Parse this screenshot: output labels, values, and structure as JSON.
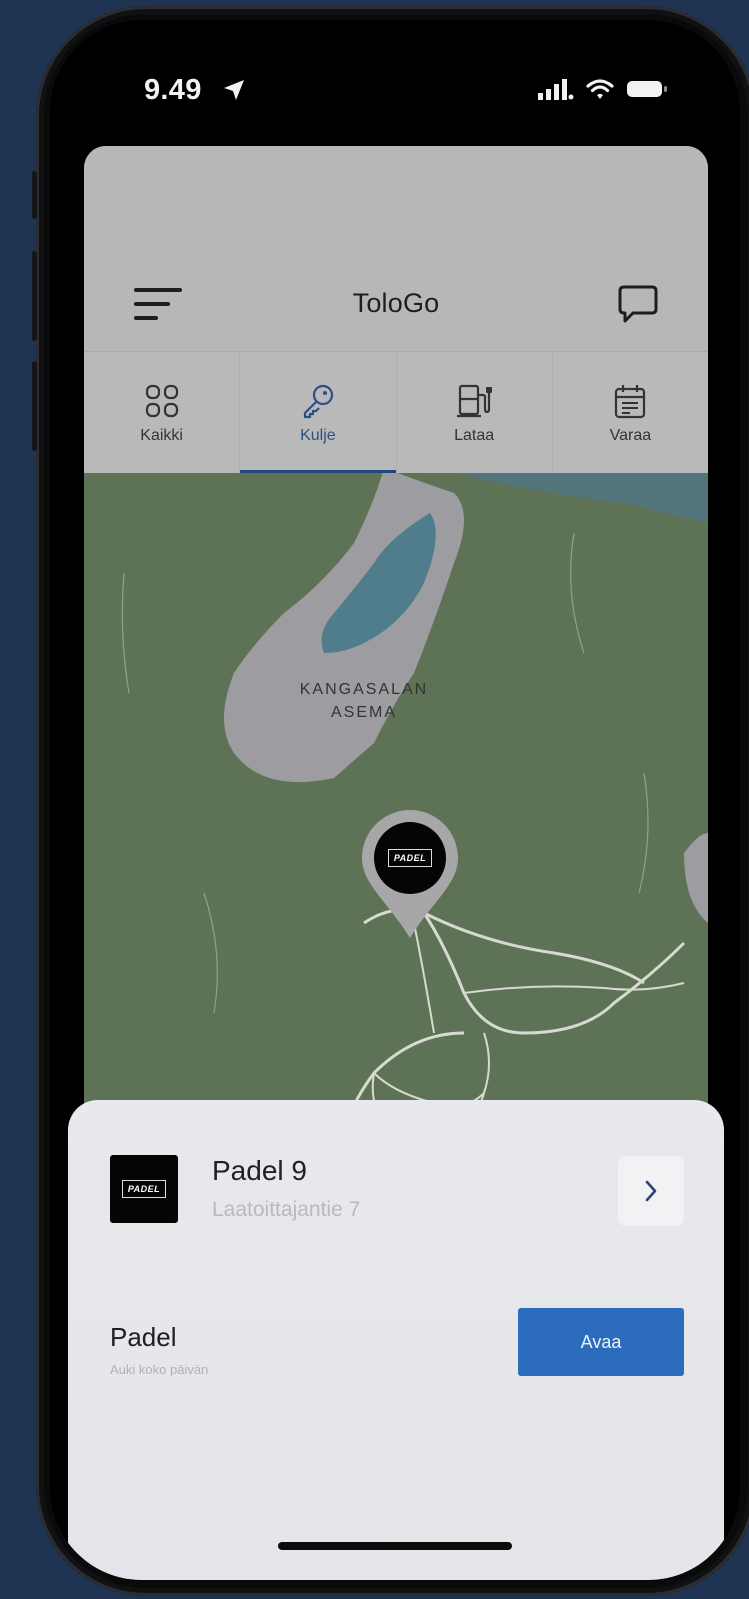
{
  "status_bar": {
    "time": "9.49"
  },
  "header": {
    "title": "ToloGo"
  },
  "tabs": [
    {
      "label": "Kaikki",
      "icon": "grid-icon"
    },
    {
      "label": "Kulje",
      "icon": "key-icon",
      "active": true
    },
    {
      "label": "Lataa",
      "icon": "ev-charger-icon"
    },
    {
      "label": "Varaa",
      "icon": "calendar-icon"
    }
  ],
  "map": {
    "area_label_line1": "KANGASALAN",
    "area_label_line2": "ASEMA",
    "pin_logo": "PADEL"
  },
  "sheet": {
    "place_logo": "PADEL",
    "place_name": "Padel 9",
    "place_address": "Laatoittajantie 7",
    "service_name": "Padel",
    "service_status": "Auki koko päivän",
    "open_button": "Avaa"
  },
  "colors": {
    "background": "#1f3453",
    "accent_tab": "#22467e",
    "open_button": "#2c6cbd",
    "map_green": "#5e7356"
  }
}
